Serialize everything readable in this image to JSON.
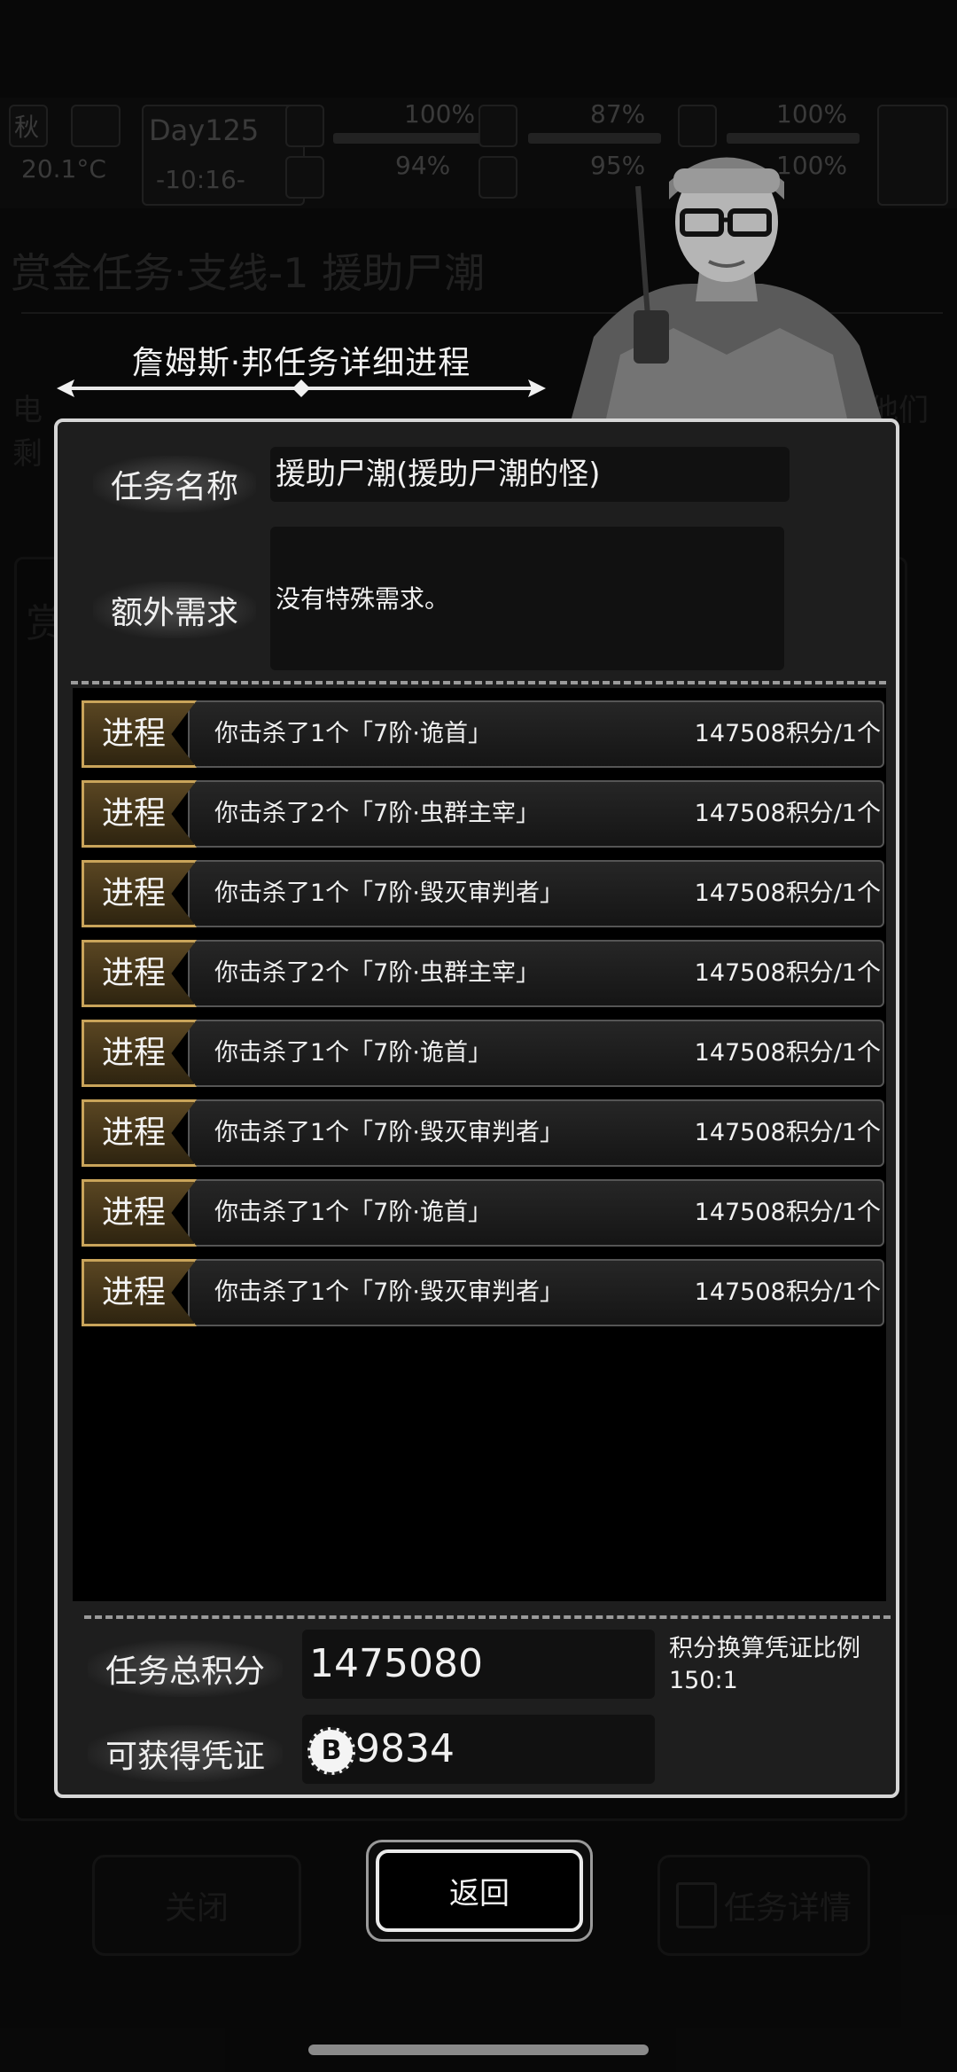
{
  "hud": {
    "season": "秋",
    "temperature": "20.1°C",
    "day": "Day125",
    "time": "-10:16-",
    "stats": [
      "100%",
      "87%",
      "100%",
      "94%",
      "95%",
      "100%"
    ]
  },
  "background": {
    "title": "赏金任务·支线-1 援助尸潮",
    "text_line1": "电",
    "text_line1_tail": "他们",
    "text_line2": "剩",
    "panel_char": "赏",
    "close_label": "关闭",
    "details_label": "任务详情"
  },
  "dialog": {
    "header_title": "詹姆斯·邦任务详细进程",
    "name_label": "任务名称",
    "name_value": "援助尸潮(援助尸潮的怪)",
    "extra_label": "额外需求",
    "extra_value": "没有特殊需求。",
    "progress": [
      {
        "tag": "进程",
        "desc": "你击杀了1个「7阶·诡首」",
        "points": "147508积分/1个"
      },
      {
        "tag": "进程",
        "desc": "你击杀了2个「7阶·虫群主宰」",
        "points": "147508积分/1个"
      },
      {
        "tag": "进程",
        "desc": "你击杀了1个「7阶·毁灭审判者」",
        "points": "147508积分/1个"
      },
      {
        "tag": "进程",
        "desc": "你击杀了2个「7阶·虫群主宰」",
        "points": "147508积分/1个"
      },
      {
        "tag": "进程",
        "desc": "你击杀了1个「7阶·诡首」",
        "points": "147508积分/1个"
      },
      {
        "tag": "进程",
        "desc": "你击杀了1个「7阶·毁灭审判者」",
        "points": "147508积分/1个"
      },
      {
        "tag": "进程",
        "desc": "你击杀了1个「7阶·诡首」",
        "points": "147508积分/1个"
      },
      {
        "tag": "进程",
        "desc": "你击杀了1个「7阶·毁灭审判者」",
        "points": "147508积分/1个"
      }
    ],
    "total_label": "任务总积分",
    "total_value": "1475080",
    "ratio_label": "积分换算凭证比例",
    "ratio_value": "150:1",
    "voucher_label": "可获得凭证",
    "voucher_value": "9834",
    "coin_symbol": "B"
  },
  "buttons": {
    "back_label": "返回"
  },
  "colors": {
    "tag_gold": "#c9a45a",
    "dialog_border": "#d6d6d6"
  }
}
